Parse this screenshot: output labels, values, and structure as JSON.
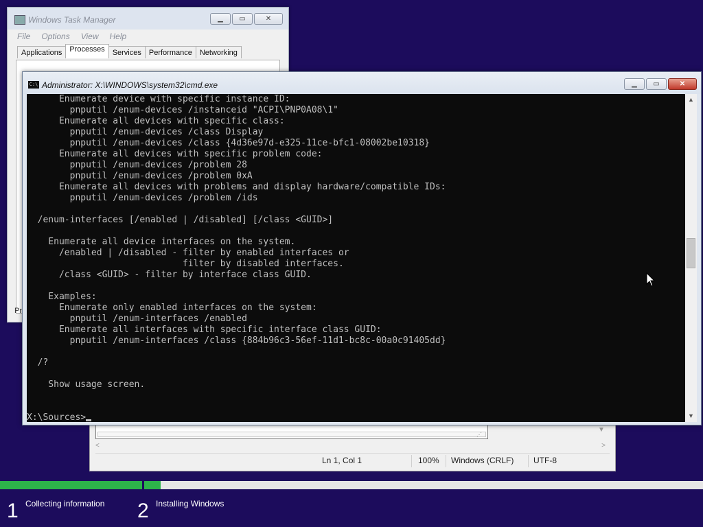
{
  "task_manager": {
    "title": "Windows Task Manager",
    "menu": [
      "File",
      "Options",
      "View",
      "Help"
    ],
    "tabs": [
      {
        "label": "Applications",
        "active": false
      },
      {
        "label": "Processes",
        "active": true
      },
      {
        "label": "Services",
        "active": false
      },
      {
        "label": "Performance",
        "active": false
      },
      {
        "label": "Networking",
        "active": false
      }
    ],
    "bottom_text": "Pr"
  },
  "cmd": {
    "title": "Administrator: X:\\WINDOWS\\system32\\cmd.exe",
    "icon_text": "C:\\",
    "lines": [
      "      Enumerate device with specific instance ID:",
      "        pnputil /enum-devices /instanceid \"ACPI\\PNP0A08\\1\"",
      "      Enumerate all devices with specific class:",
      "        pnputil /enum-devices /class Display",
      "        pnputil /enum-devices /class {4d36e97d-e325-11ce-bfc1-08002be10318}",
      "      Enumerate all devices with specific problem code:",
      "        pnputil /enum-devices /problem 28",
      "        pnputil /enum-devices /problem 0xA",
      "      Enumerate all devices with problems and display hardware/compatible IDs:",
      "        pnputil /enum-devices /problem /ids",
      "",
      "  /enum-interfaces [/enabled | /disabled] [/class <GUID>]",
      "",
      "    Enumerate all device interfaces on the system.",
      "      /enabled | /disabled - filter by enabled interfaces or",
      "                             filter by disabled interfaces.",
      "      /class <GUID> - filter by interface class GUID.",
      "",
      "    Examples:",
      "      Enumerate only enabled interfaces on the system:",
      "        pnputil /enum-interfaces /enabled",
      "      Enumerate all interfaces with specific interface class GUID:",
      "        pnputil /enum-interfaces /class {884b96c3-56ef-11d1-bc8c-00a0c91405dd}",
      "",
      "  /?",
      "",
      "    Show usage screen.",
      "",
      ""
    ],
    "prompt": "X:\\Sources>"
  },
  "notepad": {
    "status": {
      "position": "Ln 1, Col 1",
      "zoom": "100%",
      "line_ending": "Windows (CRLF)",
      "encoding": "UTF-8"
    }
  },
  "setup": {
    "steps": [
      {
        "number": "1",
        "label": "Collecting information",
        "progress": 1.0
      },
      {
        "number": "2",
        "label": "Installing Windows",
        "progress": 0.03
      }
    ]
  }
}
